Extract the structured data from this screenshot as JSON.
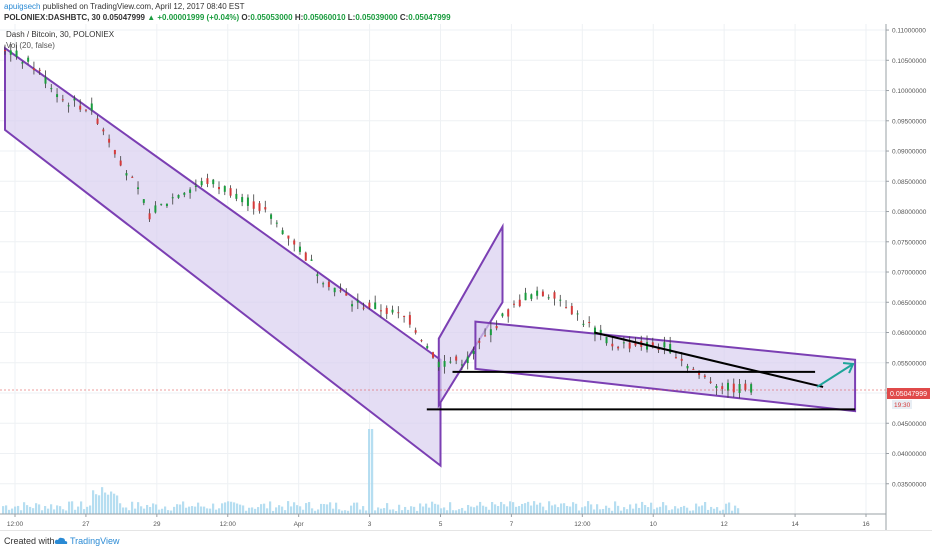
{
  "header": {
    "author": "apuigsech",
    "published_text": "published on TradingView.com, April 12, 2017 08:40 EST",
    "symbol": "POLONIEX:DASHBTC, 30",
    "last_price": "0.05047999",
    "change": "▲ +0.00001999 (+0.04%)",
    "o_label": "O:",
    "o_value": "0.05053000",
    "h_label": "H:",
    "h_value": "0.05060010",
    "l_label": "L:",
    "l_value": "0.05039000",
    "c_label": "C:",
    "c_value": "0.05047999"
  },
  "legend": {
    "main": "Dash / Bitcoin, 30, POLONIEX",
    "volume": "Vol (20, false)"
  },
  "footer": {
    "created_with": "Created with",
    "brand": "TradingView"
  },
  "colors": {
    "up": "#1a9c3e",
    "down": "#d43a3a",
    "candle": "#3b3b3b",
    "channel_fill": "#d9cff0",
    "channel_line": "#7b3fb3",
    "volume": "#a9d8ef",
    "arrow": "#1ea59a",
    "price_badge": "#e04a4a"
  },
  "chart_data": {
    "type": "candlestick",
    "instrument": "Dash / Bitcoin",
    "timeframe": "30",
    "exchange": "POLONIEX",
    "y_range": [
      0.03,
      0.111
    ],
    "y_ticks": [
      "0.11000000",
      "0.10500000",
      "0.10000000",
      "0.09500000",
      "0.09000000",
      "0.08500000",
      "0.08000000",
      "0.07500000",
      "0.07000000",
      "0.06500000",
      "0.06000000",
      "0.05500000",
      "0.05000000",
      "0.04500000",
      "0.04000000",
      "0.03500000"
    ],
    "x_ticks": [
      "12:00",
      "27",
      "29",
      "12:00",
      "Apr",
      "3",
      "5",
      "7",
      "12:00",
      "10",
      "12",
      "14",
      "16"
    ],
    "price_series": [
      [
        0.107,
        0.106
      ],
      [
        0.104,
        0.102
      ],
      [
        0.0985,
        0.096
      ],
      [
        0.097,
        0.093
      ],
      [
        0.0885,
        0.084
      ],
      [
        0.0795,
        0.0775
      ],
      [
        0.083,
        0.085
      ],
      [
        0.085,
        0.084
      ],
      [
        0.083,
        0.081
      ],
      [
        0.08,
        0.077
      ],
      [
        0.075,
        0.072
      ],
      [
        0.069,
        0.067
      ],
      [
        0.065,
        0.0645
      ],
      [
        0.064,
        0.0632
      ],
      [
        0.062,
        0.06
      ],
      [
        0.055,
        0.05
      ],
      [
        0.0555,
        0.056
      ],
      [
        0.0615,
        0.064
      ],
      [
        0.066,
        0.0675
      ],
      [
        0.0665,
        0.0665
      ],
      [
        0.062,
        0.059
      ],
      [
        0.058,
        0.0575
      ],
      [
        0.058,
        0.0592
      ],
      [
        0.0575,
        0.056
      ],
      [
        0.053,
        0.052
      ],
      [
        0.0508,
        0.0505
      ]
    ],
    "last_price_label": "0.05047999",
    "countdown_label": "19:30",
    "volume_spike_at": "3",
    "annotations": [
      {
        "type": "descending channel",
        "from": "12:00",
        "to": "5"
      },
      {
        "type": "ascending channel",
        "from": "3",
        "to": "5"
      },
      {
        "type": "descending channel",
        "from": "7",
        "to": "14"
      },
      {
        "type": "horizontal line",
        "level": 0.0473
      },
      {
        "type": "horizontal line",
        "level": 0.0535
      },
      {
        "type": "trendline",
        "from": 0.06,
        "to": 0.051
      },
      {
        "type": "arrow",
        "from": 0.051,
        "to": 0.0548
      }
    ]
  }
}
